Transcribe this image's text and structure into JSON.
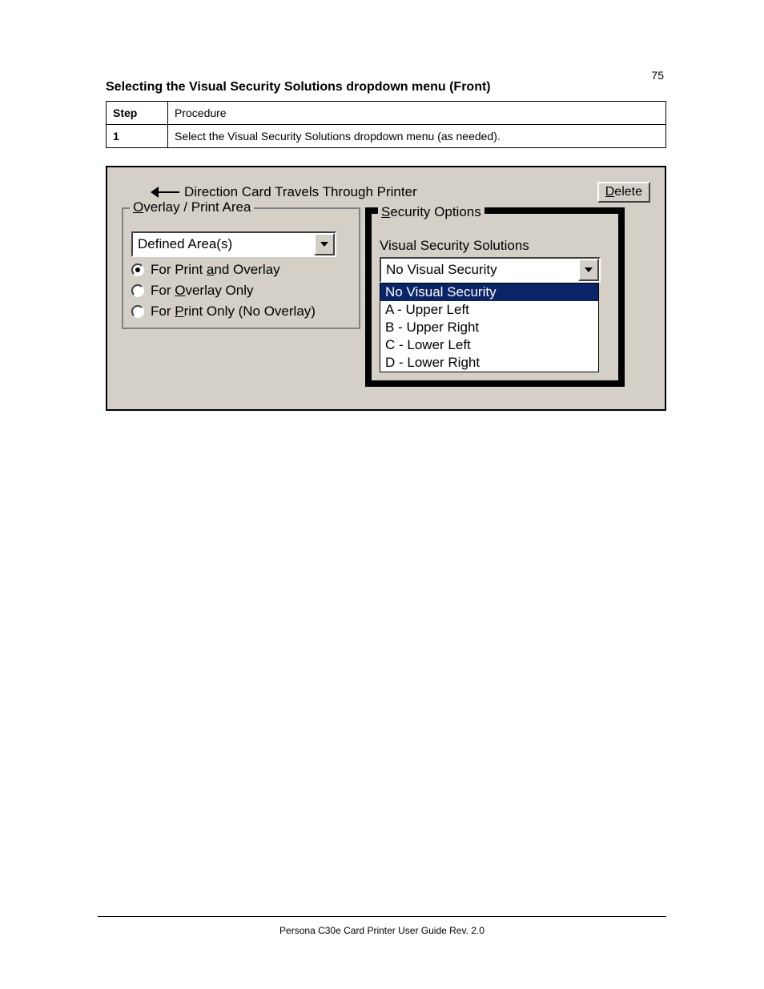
{
  "page_number": "75",
  "heading": "Selecting the Visual Security Solutions dropdown menu (Front)",
  "rows": [
    {
      "step": "Step",
      "procedure": "Procedure"
    },
    {
      "step": "1",
      "procedure": "Select  the  Visual  Security  Solutions  dropdown  menu  (as needed)."
    }
  ],
  "shot": {
    "direction_label": "Direction Card Travels Through Printer",
    "delete_label": "Delete",
    "overlay_group_legend": "Overlay / Print Area",
    "overlay_combo_value": "Defined Area(s)",
    "overlay_radios": [
      {
        "checked": true,
        "pre": "For Print ",
        "underlined": "a",
        "post": "nd Overlay"
      },
      {
        "checked": false,
        "pre": "For ",
        "underlined": "O",
        "post": "verlay Only"
      },
      {
        "checked": false,
        "pre": "For ",
        "underlined": "P",
        "post": "rint Only (No Overlay)"
      }
    ],
    "security_group_legend": "Security Options",
    "security_sublabel": "Visual Security Solutions",
    "security_combo_value": "No Visual Security",
    "security_options": [
      "No Visual Security",
      "A - Upper Left",
      "B - Upper Right",
      "C - Lower Left",
      "D - Lower Right"
    ],
    "security_selected_index": 0
  },
  "footer": "Persona C30e Card Printer User Guide Rev. 2.0"
}
